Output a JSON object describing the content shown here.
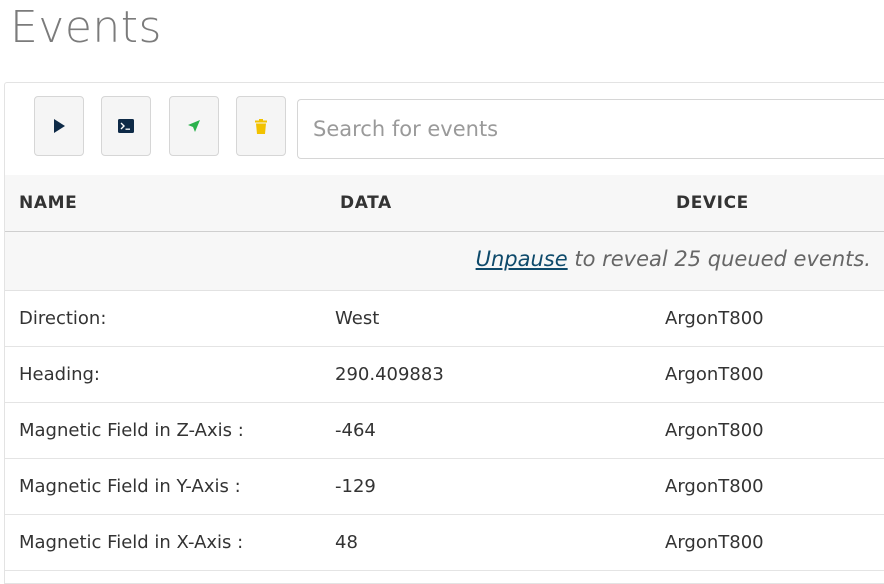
{
  "page": {
    "title": "Events"
  },
  "toolbar": {
    "buttons": [
      {
        "name": "play-button",
        "icon": "play-icon",
        "color": "#0e2a47"
      },
      {
        "name": "console-button",
        "icon": "terminal-icon",
        "color": "#0e2a47"
      },
      {
        "name": "publish-button",
        "icon": "send-icon",
        "color": "#2bb24c"
      },
      {
        "name": "clear-button",
        "icon": "trash-icon",
        "color": "#f2c200"
      }
    ],
    "search_placeholder": "Search for events"
  },
  "table": {
    "columns": [
      "NAME",
      "DATA",
      "DEVICE"
    ],
    "banner": {
      "link": "Unpause",
      "text": " to reveal 25 queued events."
    },
    "rows": [
      {
        "name": "Direction:",
        "data": "West",
        "device": "ArgonT800"
      },
      {
        "name": "Heading:",
        "data": "290.409883",
        "device": "ArgonT800"
      },
      {
        "name": "Magnetic Field in Z-Axis :",
        "data": "-464",
        "device": "ArgonT800"
      },
      {
        "name": "Magnetic Field in Y-Axis :",
        "data": "-129",
        "device": "ArgonT800"
      },
      {
        "name": "Magnetic Field in X-Axis :",
        "data": "48",
        "device": "ArgonT800"
      }
    ]
  }
}
